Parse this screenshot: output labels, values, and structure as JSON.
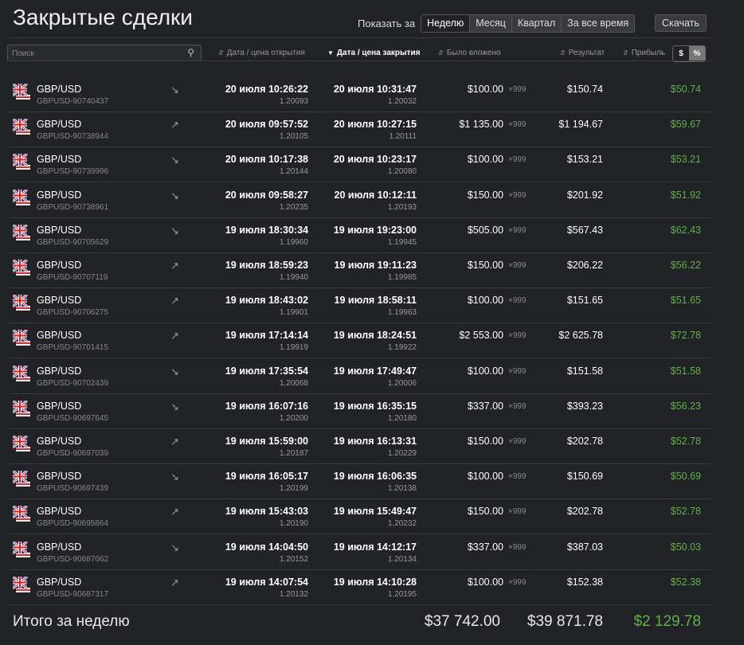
{
  "header": {
    "title": "Закрытые сделки",
    "show_label": "Показать за",
    "periods": [
      "Неделю",
      "Месяц",
      "Квартал",
      "За все время"
    ],
    "download": "Скачать"
  },
  "table": {
    "search_placeholder": "Поиск",
    "columns": {
      "open": "Дата / цена открытия",
      "close": "Дата / цена закрытия",
      "invested": "Было вложено",
      "result": "Результат",
      "profit": "Прибыль"
    },
    "toggle": [
      "$",
      "%"
    ]
  },
  "colors": {
    "profit": "#5fb14a",
    "background": "#222326"
  },
  "rows": [
    {
      "pair": "GBP/USD",
      "id": "GBPUSD-90740437",
      "dir": "down",
      "open_date": "20 июля 10:26:22",
      "open_price": "1.20093",
      "close_date": "20 июля 10:31:47",
      "close_price": "1.20032",
      "invested": "$100.00",
      "leverage": "×999",
      "result": "$150.74",
      "profit": "$50.74"
    },
    {
      "pair": "GBP/USD",
      "id": "GBPUSD-90738944",
      "dir": "up",
      "open_date": "20 июля 09:57:52",
      "open_price": "1.20105",
      "close_date": "20 июля 10:27:15",
      "close_price": "1.20111",
      "invested": "$1 135.00",
      "leverage": "×999",
      "result": "$1 194.67",
      "profit": "$59.67"
    },
    {
      "pair": "GBP/USD",
      "id": "GBPUSD-90739996",
      "dir": "down",
      "open_date": "20 июля 10:17:38",
      "open_price": "1.20144",
      "close_date": "20 июля 10:23:17",
      "close_price": "1.20080",
      "invested": "$100.00",
      "leverage": "×999",
      "result": "$153.21",
      "profit": "$53.21"
    },
    {
      "pair": "GBP/USD",
      "id": "GBPUSD-90738961",
      "dir": "down",
      "open_date": "20 июля 09:58:27",
      "open_price": "1.20235",
      "close_date": "20 июля 10:12:11",
      "close_price": "1.20193",
      "invested": "$150.00",
      "leverage": "×999",
      "result": "$201.92",
      "profit": "$51.92"
    },
    {
      "pair": "GBP/USD",
      "id": "GBPUSD-90705629",
      "dir": "down",
      "open_date": "19 июля 18:30:34",
      "open_price": "1.19960",
      "close_date": "19 июля 19:23:00",
      "close_price": "1.19945",
      "invested": "$505.00",
      "leverage": "×999",
      "result": "$567.43",
      "profit": "$62.43"
    },
    {
      "pair": "GBP/USD",
      "id": "GBPUSD-90707119",
      "dir": "up",
      "open_date": "19 июля 18:59:23",
      "open_price": "1.19940",
      "close_date": "19 июля 19:11:23",
      "close_price": "1.19985",
      "invested": "$150.00",
      "leverage": "×999",
      "result": "$206.22",
      "profit": "$56.22"
    },
    {
      "pair": "GBP/USD",
      "id": "GBPUSD-90706275",
      "dir": "up",
      "open_date": "19 июля 18:43:02",
      "open_price": "1.19901",
      "close_date": "19 июля 18:58:11",
      "close_price": "1.19963",
      "invested": "$100.00",
      "leverage": "×999",
      "result": "$151.65",
      "profit": "$51.65"
    },
    {
      "pair": "GBP/USD",
      "id": "GBPUSD-90701415",
      "dir": "up",
      "open_date": "19 июля 17:14:14",
      "open_price": "1.19919",
      "close_date": "19 июля 18:24:51",
      "close_price": "1.19922",
      "invested": "$2 553.00",
      "leverage": "×999",
      "result": "$2 625.78",
      "profit": "$72.78"
    },
    {
      "pair": "GBP/USD",
      "id": "GBPUSD-90702439",
      "dir": "down",
      "open_date": "19 июля 17:35:54",
      "open_price": "1.20068",
      "close_date": "19 июля 17:49:47",
      "close_price": "1.20006",
      "invested": "$100.00",
      "leverage": "×999",
      "result": "$151.58",
      "profit": "$51.58"
    },
    {
      "pair": "GBP/USD",
      "id": "GBPUSD-90697645",
      "dir": "down",
      "open_date": "19 июля 16:07:16",
      "open_price": "1.20200",
      "close_date": "19 июля 16:35:15",
      "close_price": "1.20180",
      "invested": "$337.00",
      "leverage": "×999",
      "result": "$393.23",
      "profit": "$56.23"
    },
    {
      "pair": "GBP/USD",
      "id": "GBPUSD-90697039",
      "dir": "up",
      "open_date": "19 июля 15:59:00",
      "open_price": "1.20187",
      "close_date": "19 июля 16:13:31",
      "close_price": "1.20229",
      "invested": "$150.00",
      "leverage": "×999",
      "result": "$202.78",
      "profit": "$52.78"
    },
    {
      "pair": "GBP/USD",
      "id": "GBPUSD-90697439",
      "dir": "down",
      "open_date": "19 июля 16:05:17",
      "open_price": "1.20199",
      "close_date": "19 июля 16:06:35",
      "close_price": "1.20138",
      "invested": "$100.00",
      "leverage": "×999",
      "result": "$150.69",
      "profit": "$50.69"
    },
    {
      "pair": "GBP/USD",
      "id": "GBPUSD-90695864",
      "dir": "up",
      "open_date": "19 июля 15:43:03",
      "open_price": "1.20190",
      "close_date": "19 июля 15:49:47",
      "close_price": "1.20232",
      "invested": "$150.00",
      "leverage": "×999",
      "result": "$202.78",
      "profit": "$52.78"
    },
    {
      "pair": "GBP/USD",
      "id": "GBPUSD-90687062",
      "dir": "down",
      "open_date": "19 июля 14:04:50",
      "open_price": "1.20152",
      "close_date": "19 июля 14:12:17",
      "close_price": "1.20134",
      "invested": "$337.00",
      "leverage": "×999",
      "result": "$387.03",
      "profit": "$50.03"
    },
    {
      "pair": "GBP/USD",
      "id": "GBPUSD-90687317",
      "dir": "up",
      "open_date": "19 июля 14:07:54",
      "open_price": "1.20132",
      "close_date": "19 июля 14:10:28",
      "close_price": "1.20195",
      "invested": "$100.00",
      "leverage": "×999",
      "result": "$152.38",
      "profit": "$52.38"
    }
  ],
  "totals": {
    "label": "Итого за неделю",
    "invested": "$37 742.00",
    "result": "$39 871.78",
    "profit": "$2 129.78"
  }
}
